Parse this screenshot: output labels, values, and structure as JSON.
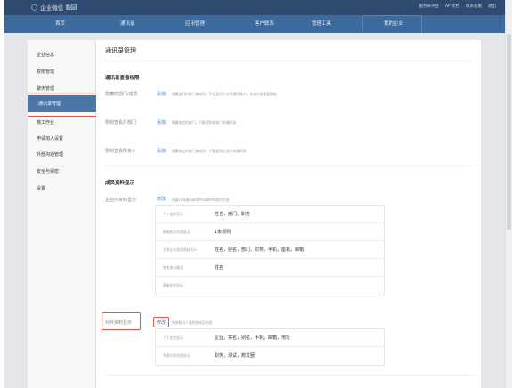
{
  "app": {
    "name": "企业微信",
    "badge": "后台"
  },
  "top_links": [
    "服务商平台",
    "API文档",
    "联系客服",
    "退出"
  ],
  "nav": {
    "items": [
      "首页",
      "通讯录",
      "应用管理",
      "客户联系",
      "管理工具",
      "我的企业"
    ]
  },
  "sidebar": {
    "items": [
      "企业信息",
      "权限管理",
      "聊天管理",
      "通讯录管理",
      "微工作台",
      "申请加入设置",
      "外部沟通管理",
      "安全与保密",
      "设置"
    ]
  },
  "main": {
    "title": "通讯录管理",
    "sec_perm": {
      "title": "通讯录查看权限",
      "rows": [
        {
          "label": "隐藏的部门/成员",
          "action": "添加",
          "hint": "隐藏部门的部门或成员，不会显示在公司通讯录中，仅允许查看直接被"
        },
        {
          "label": "限制查看外部门",
          "action": "添加",
          "hint": "隐藏指定的部门，只能看到本部门的通讯录"
        },
        {
          "label": "限制查看所有人",
          "action": "添加",
          "hint": "隐藏指定的部门或成员，只能看到企业内有通讯录"
        }
      ]
    },
    "sec_member": {
      "title": "成员资料显示",
      "internal": {
        "label": "企业内资料显示",
        "action": "修改",
        "hint": "在展开规通讯录和手机端中的成员信息",
        "rows": [
          {
            "key": "个人信息显示",
            "value": "姓名，部门，职务"
          },
          {
            "key": "邮箱成员内容显示",
            "value": "1条规则"
          },
          {
            "key": "互联企业成员资料显示",
            "value": "姓名，别名，部门，职务，手机，座机，邮箱"
          },
          {
            "key": "姓名显示模式",
            "value": "姓名"
          },
          {
            "key": "直接姓名显示",
            "value": ""
          }
        ]
      },
      "external": {
        "label": "对外资料显示",
        "action": "修改",
        "hint": "外部联系人看到的成员信息",
        "rows": [
          {
            "key": "个人信息显示",
            "value": "企业，实名，别名，手机，邮箱，地址"
          },
          {
            "key": "专属对外信息显示",
            "value": "职务，测试，赠发圈"
          }
        ]
      }
    }
  }
}
